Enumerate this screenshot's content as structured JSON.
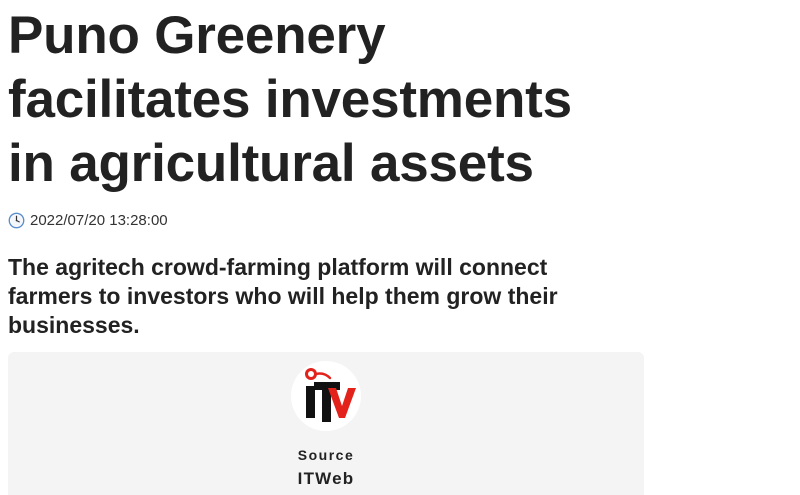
{
  "article": {
    "headline": "Puno Greenery facilitates investments in agricultural assets",
    "timestamp": "2022/07/20 13:28:00",
    "clock_icon": "clock-icon",
    "standfirst": "The agritech crowd-farming platform will connect farmers to investors who will help them grow their businesses."
  },
  "source": {
    "label": "Source",
    "name": "ITWeb",
    "logo_icon": "itweb-logo",
    "colors": {
      "box_background": "#f4f4f4",
      "logo_red": "#e3231b",
      "logo_black": "#111111"
    }
  }
}
